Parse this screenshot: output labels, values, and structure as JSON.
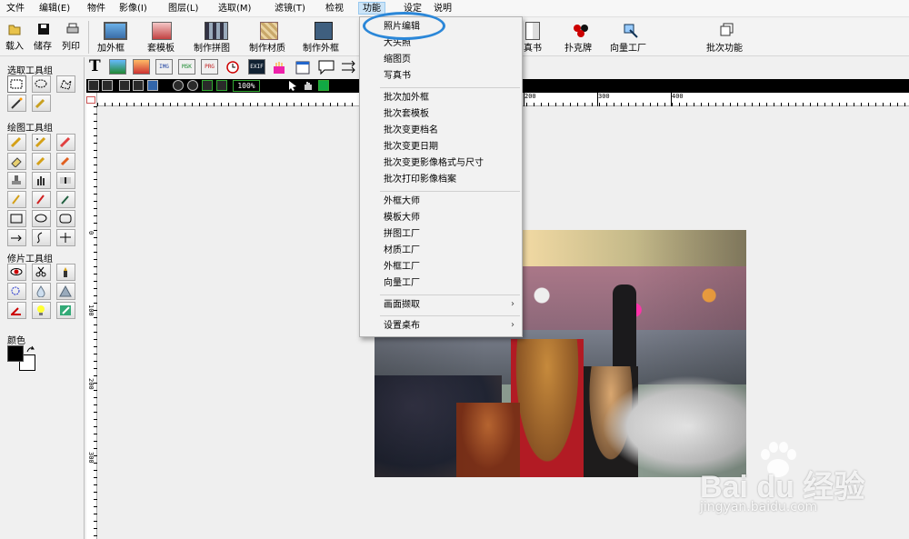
{
  "menubar": {
    "items": [
      "文件",
      "编辑(E)",
      "物件",
      "影像(I)",
      "图层(L)",
      "选取(M)",
      "滤镜(T)",
      "检视",
      "功能",
      "设定",
      "说明"
    ],
    "active_index": 8
  },
  "toolbar": {
    "items": [
      "载入",
      "储存",
      "列印",
      "加外框",
      "套模板",
      "制作拼图",
      "制作材质",
      "制作外框",
      "真书",
      "扑克牌",
      "向量工厂",
      "批次功能"
    ]
  },
  "left_panel": {
    "select_group": "选取工具组",
    "draw_group": "绘图工具组",
    "retouch_group": "修片工具组",
    "color_label": "颜色",
    "foreground_color": "#000000",
    "background_color": "#ffffff"
  },
  "shape_tools": [
    "T",
    "",
    "",
    "IMG",
    "MSK",
    "PRG",
    "",
    "EXIF",
    "",
    "",
    ""
  ],
  "zoom": "100%",
  "ruler": {
    "top": [
      "200",
      "300",
      "400"
    ],
    "left": [
      "0",
      "100",
      "200",
      "300"
    ]
  },
  "dropdown": {
    "items": [
      {
        "label": "照片编辑",
        "submenu": false
      },
      {
        "label": "大头照",
        "submenu": false
      },
      {
        "label": "缩图页",
        "submenu": false
      },
      {
        "label": "写真书",
        "submenu": false
      },
      {
        "label": "批次加外框",
        "submenu": false
      },
      {
        "label": "批次套模板",
        "submenu": false
      },
      {
        "label": "批次变更档名",
        "submenu": false
      },
      {
        "label": "批次变更日期",
        "submenu": false
      },
      {
        "label": "批次变更影像格式与尺寸",
        "submenu": false
      },
      {
        "label": "批次打印影像档案",
        "submenu": false
      },
      {
        "label": "外框大师",
        "submenu": false
      },
      {
        "label": "模板大师",
        "submenu": false
      },
      {
        "label": "拼图工厂",
        "submenu": false
      },
      {
        "label": "材质工厂",
        "submenu": false
      },
      {
        "label": "外框工厂",
        "submenu": false
      },
      {
        "label": "向量工厂",
        "submenu": false
      },
      {
        "label": "画面撷取",
        "submenu": true
      },
      {
        "label": "设置桌布",
        "submenu": true
      }
    ],
    "highlight_color": "#2b87d8"
  },
  "watermark": {
    "brand": "Bai du 经验",
    "url": "jingyan.baidu.com"
  }
}
